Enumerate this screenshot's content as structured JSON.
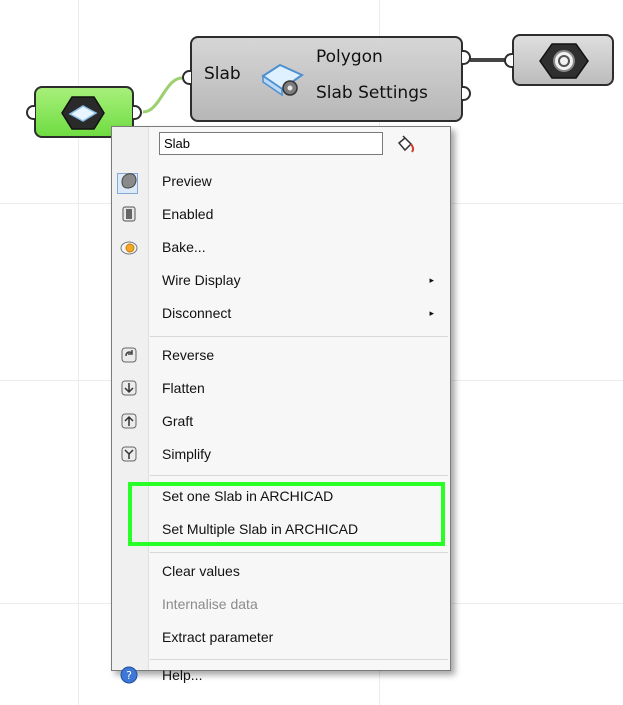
{
  "canvas": {
    "background_color": "#ffffff",
    "grid_color": "#ececec"
  },
  "components": {
    "slab": {
      "input_label": "Slab",
      "outputs": [
        "Polygon",
        "Slab Settings"
      ],
      "icon": "slab-settings-icon"
    },
    "green_param": {
      "color": "#6fdc42",
      "icon": "slab-param-icon"
    },
    "right_param": {
      "icon": "settings-nut-icon"
    }
  },
  "menu": {
    "name_input_value": "Slab",
    "paint_icon": "paint-bucket-icon",
    "items": [
      {
        "label": "Preview",
        "icon": "preview-icon"
      },
      {
        "label": "Enabled",
        "icon": "enabled-icon"
      },
      {
        "label": "Bake...",
        "icon": "bake-icon"
      },
      {
        "label": "Wire Display",
        "icon": "",
        "submenu": "▸"
      },
      {
        "label": "Disconnect",
        "icon": "",
        "submenu": "▸"
      },
      {
        "label": "Reverse",
        "icon": "reverse-icon"
      },
      {
        "label": "Flatten",
        "icon": "flatten-icon"
      },
      {
        "label": "Graft",
        "icon": "graft-icon"
      },
      {
        "label": "Simplify",
        "icon": "simplify-icon"
      },
      {
        "label": "Set one Slab in ARCHICAD",
        "icon": ""
      },
      {
        "label": "Set Multiple Slab in ARCHICAD",
        "icon": ""
      },
      {
        "label": "Clear values",
        "icon": ""
      },
      {
        "label": "Internalise data",
        "icon": ""
      },
      {
        "label": "Extract parameter",
        "icon": ""
      },
      {
        "label": "Help...",
        "icon": "help-icon"
      }
    ]
  },
  "highlight": {
    "color": "#27ff27"
  }
}
